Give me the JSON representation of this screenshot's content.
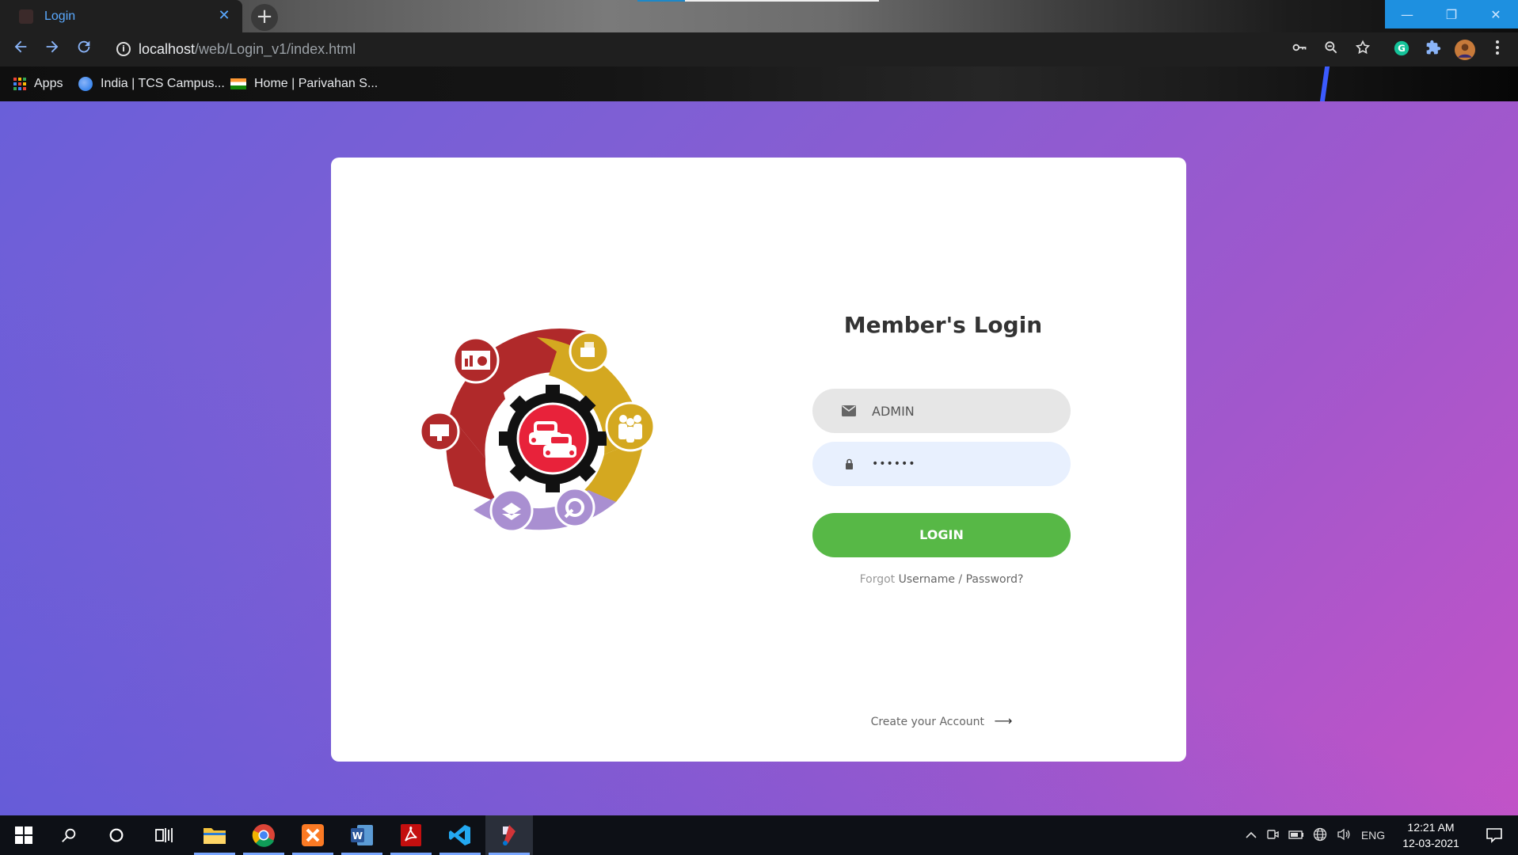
{
  "browser": {
    "tab_title": "Login",
    "tab_close": "✕",
    "new_tab": "+",
    "url_host": "localhost",
    "url_path": "/web/Login_v1/index.html",
    "window_controls": {
      "minimize": "—",
      "restore": "❐",
      "close": "✕"
    },
    "bookmarks": [
      {
        "label": "Apps"
      },
      {
        "label": "India | TCS Campus..."
      },
      {
        "label": "Home | Parivahan S..."
      }
    ]
  },
  "login": {
    "title": "Member's Login",
    "username_value": "ADMIN",
    "password_value": "••••••",
    "button_label": "LOGIN",
    "forgot_prefix": "Forgot",
    "forgot_link": "Username / Password?",
    "create_account": "Create your Account",
    "create_arrow": "⟶"
  },
  "taskbar": {
    "language": "ENG",
    "time": "12:21 AM",
    "date": "12-03-2021"
  },
  "colors": {
    "login_button": "#57b846",
    "logo_red": "#b0292a",
    "logo_gold": "#d4a820",
    "logo_purple": "#a98fd1",
    "logo_center": "#e8223a"
  }
}
